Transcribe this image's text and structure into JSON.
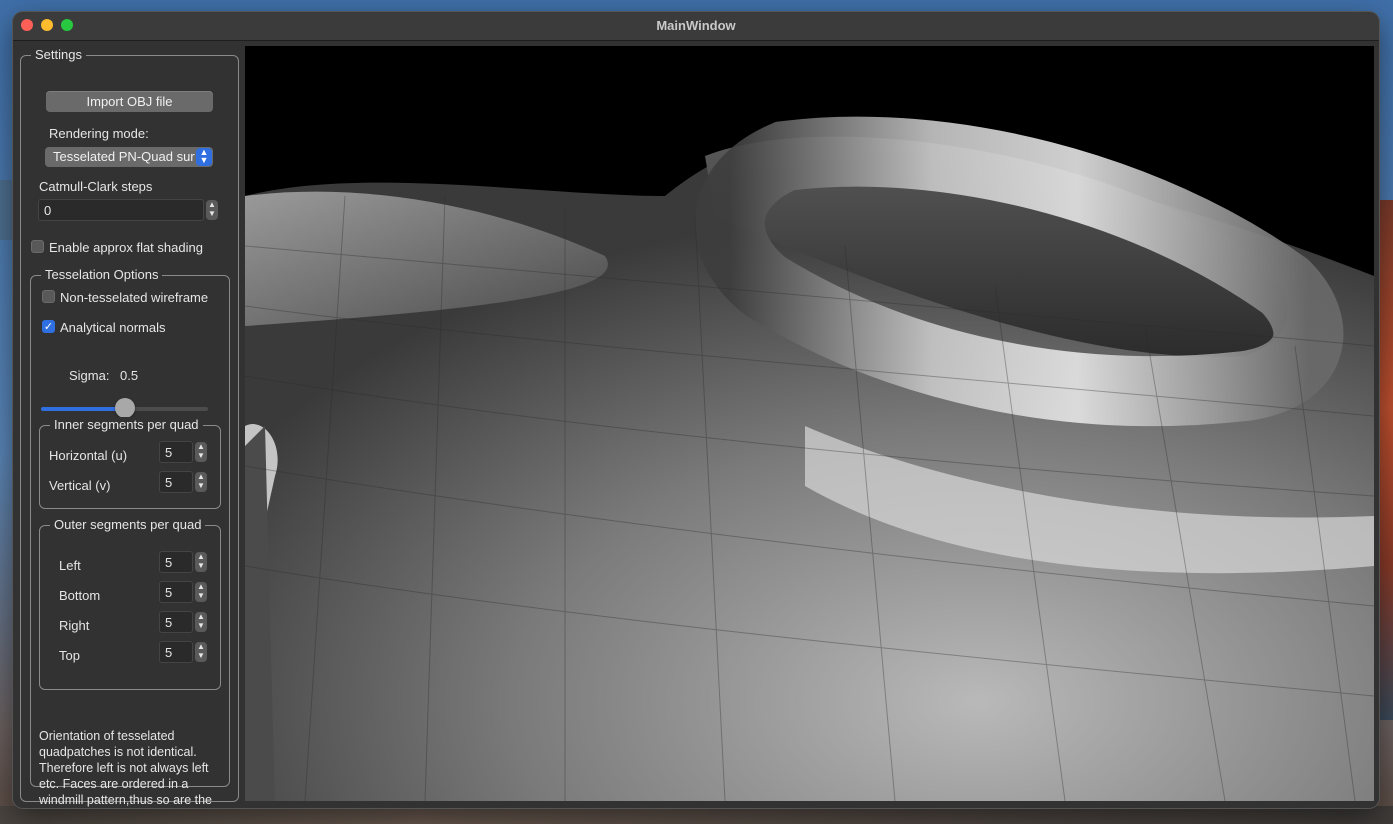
{
  "window": {
    "title": "MainWindow"
  },
  "settings": {
    "title": "Settings",
    "import_button": "Import OBJ file",
    "rendering_mode_label": "Rendering mode:",
    "rendering_mode_value": "Tesselated PN-Quad surface",
    "catmull_label": "Catmull-Clark steps",
    "catmull_value": "0",
    "flat_shading_label": "Enable approx flat shading",
    "flat_shading_checked": false
  },
  "tesselation": {
    "title": "Tesselation Options",
    "wireframe_label": "Non-tesselated wireframe",
    "wireframe_checked": false,
    "normals_label": "Analytical normals",
    "normals_checked": true,
    "sigma_label": "Sigma:",
    "sigma_value": "0.5",
    "sigma_fraction": 0.5,
    "inner": {
      "title": "Inner segments per quad",
      "horizontal_label": "Horizontal  (u)",
      "horizontal_value": "5",
      "vertical_label": "Vertical      (v)",
      "vertical_value": "5"
    },
    "outer": {
      "title": "Outer segments per quad",
      "left_label": "Left",
      "left_value": "5",
      "bottom_label": "Bottom",
      "bottom_value": "5",
      "right_label": "Right",
      "right_value": "5",
      "top_label": "Top",
      "top_value": "5"
    },
    "note": "Orientation of tesselated quadpatches is not identical. Therefore left is not always left etc. Faces are ordered in a windmill pattern,thus so are the quad patches."
  },
  "colors": {
    "accent": "#2f6fe0",
    "window_bg": "#323232",
    "viewport_bg": "#000000"
  }
}
